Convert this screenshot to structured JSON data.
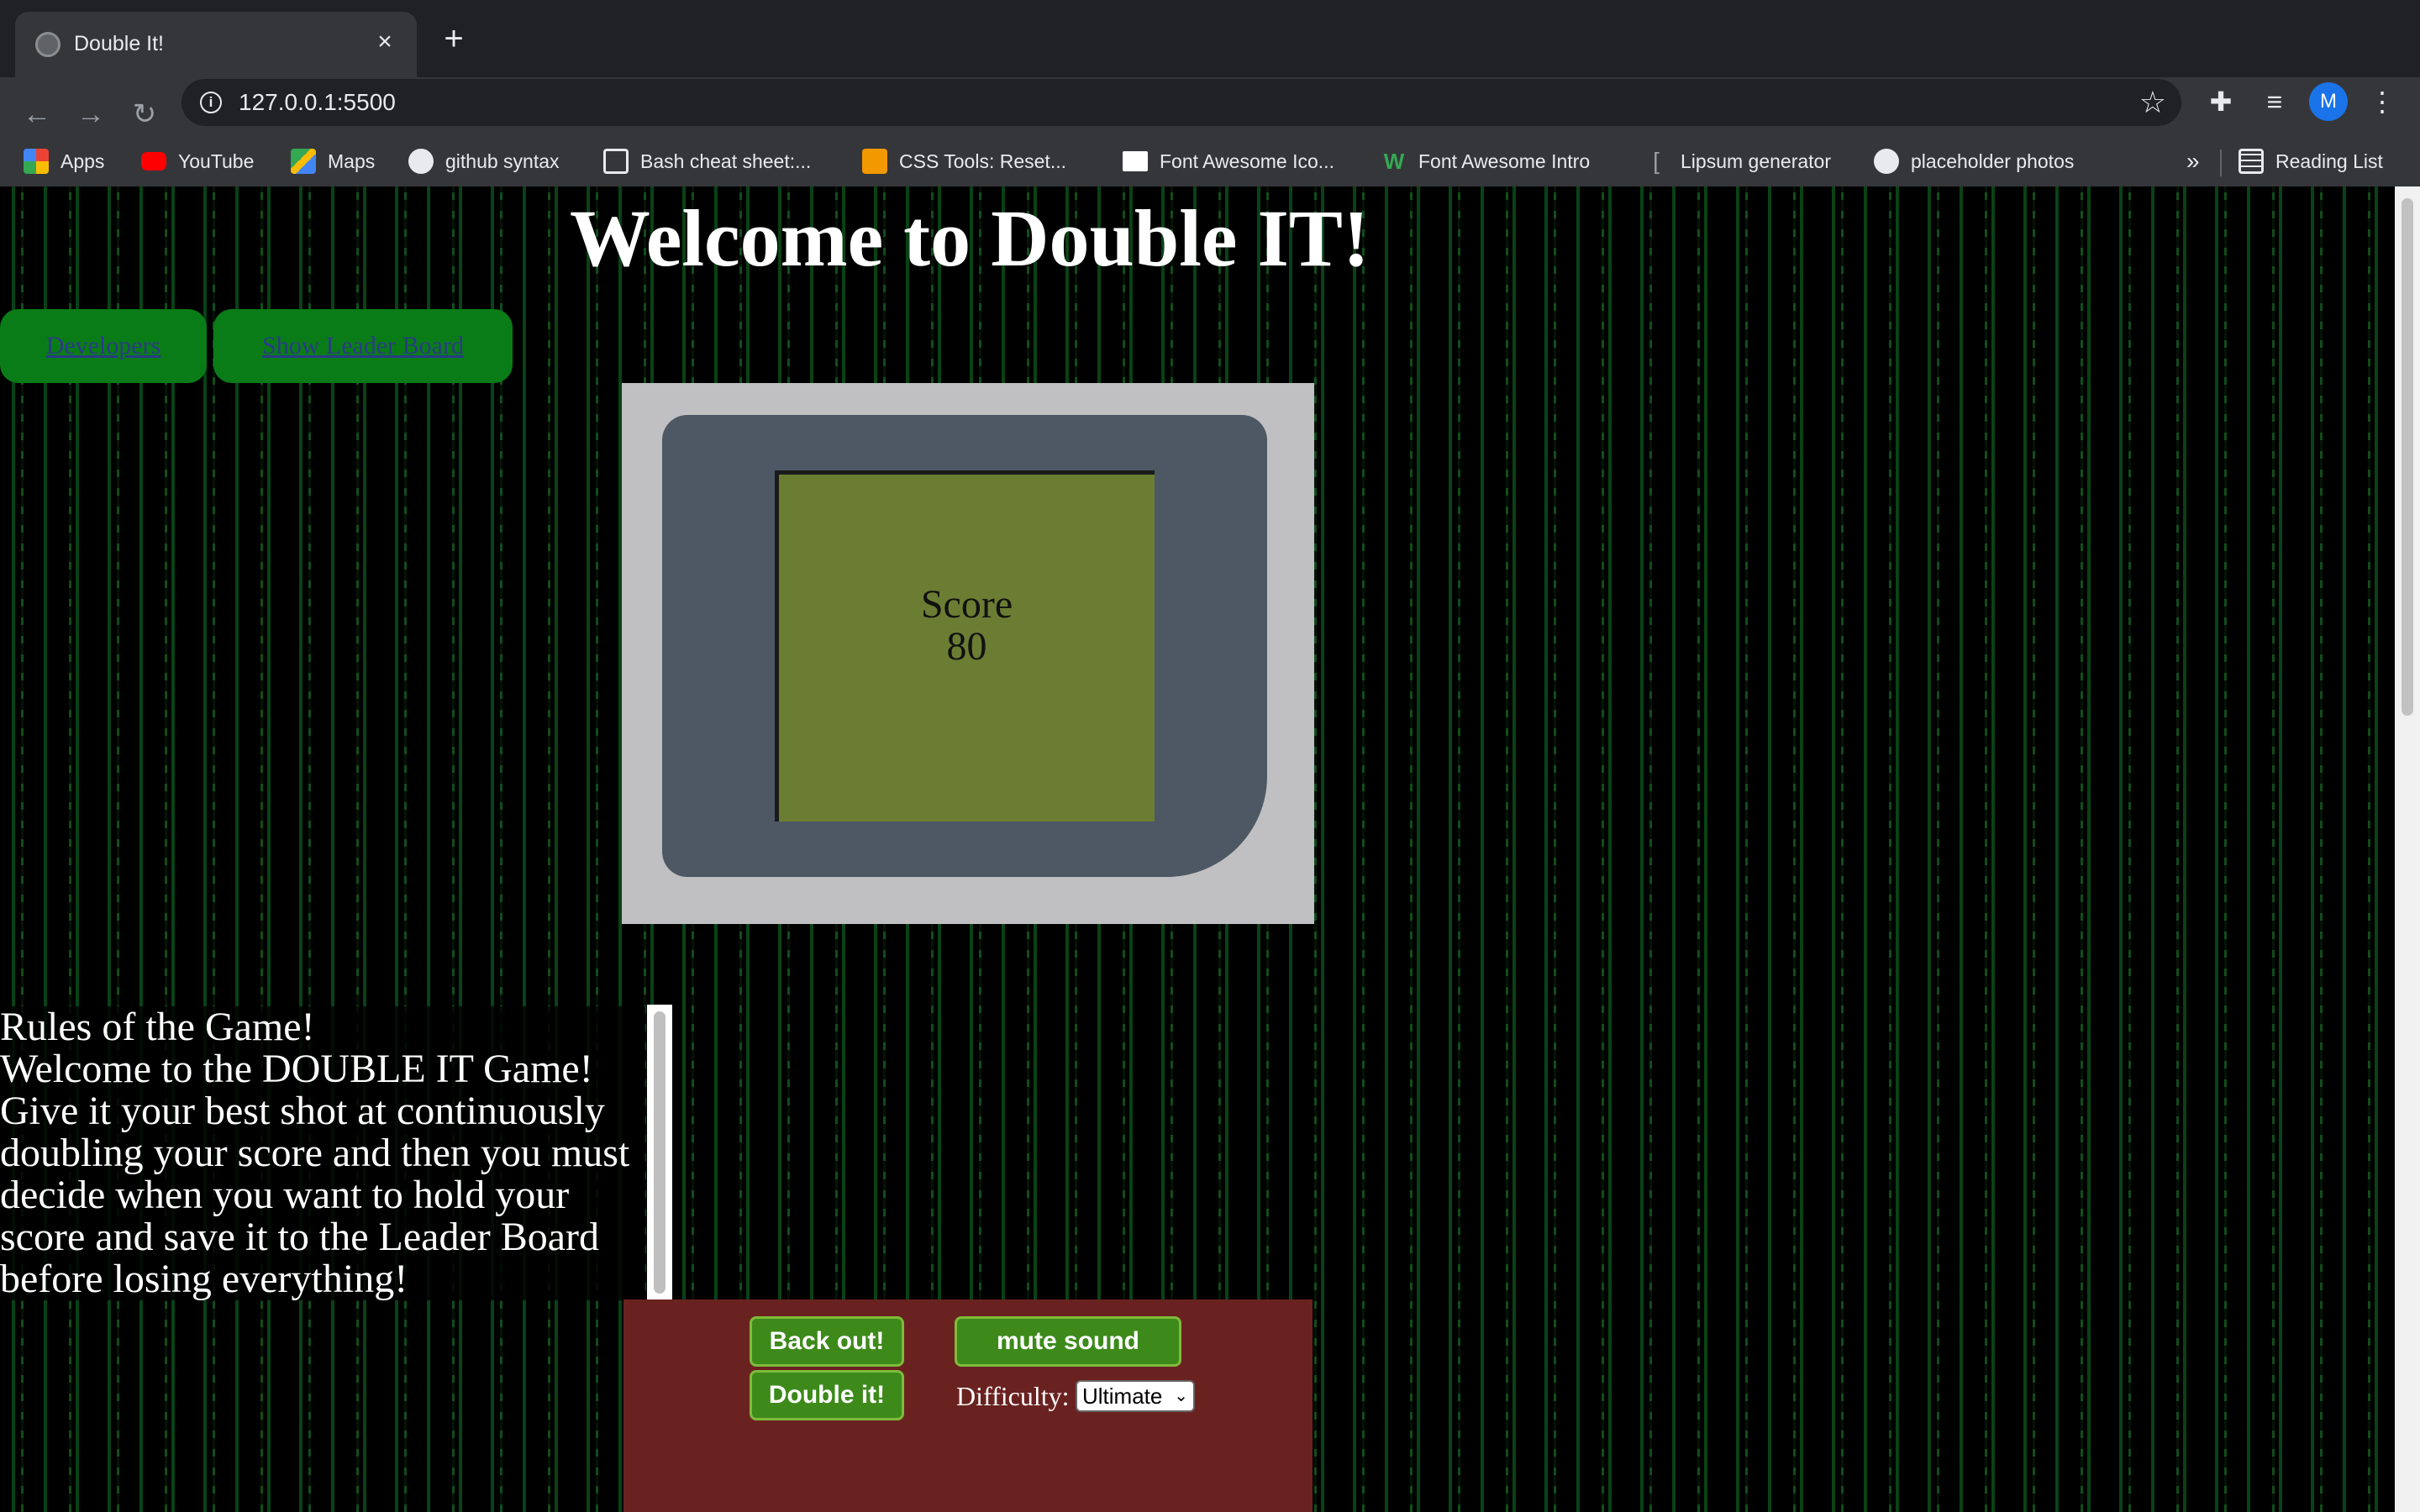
{
  "browser": {
    "tab": {
      "title": "Double It!",
      "close": "×"
    },
    "new_tab": "+",
    "nav": {
      "back": "←",
      "forward": "→",
      "reload": "↻"
    },
    "address": {
      "info": "i",
      "url": "127.0.0.1:5500",
      "star": "☆"
    },
    "toolbar_icons": {
      "extensions": "✚",
      "media": "≡",
      "profile": "M",
      "menu": "⋮"
    },
    "bookmarks": [
      {
        "label": "Apps",
        "icon": "apps-grid-icon",
        "color": "#ea4335"
      },
      {
        "label": "YouTube",
        "icon": "youtube-icon",
        "color": "#ff0000"
      },
      {
        "label": "Maps",
        "icon": "maps-icon",
        "color": "#34a853"
      },
      {
        "label": "github syntax",
        "icon": "github-icon",
        "color": "#e8eaed"
      },
      {
        "label": "Bash cheat sheet:...",
        "icon": "terminal-icon",
        "color": "#e8eaed"
      },
      {
        "label": "CSS Tools: Reset...",
        "icon": "tiger-icon",
        "color": "#f29900"
      },
      {
        "label": "Font Awesome Ico...",
        "icon": "flag-icon",
        "color": "#ffffff"
      },
      {
        "label": "Font Awesome Intro",
        "icon": "w-logo-icon",
        "color": "#34a853"
      },
      {
        "label": "Lipsum generator",
        "icon": "bracket-icon",
        "color": "#9aa0a6"
      },
      {
        "label": "placeholder photos",
        "icon": "globe-icon",
        "color": "#e8eaed"
      }
    ],
    "bookmarks_overflow": "»",
    "reading_list": "Reading List"
  },
  "page": {
    "title": "Welcome to Double IT!",
    "nav_buttons": {
      "developers": "Developers",
      "leaderboard": "Show Leader Board"
    },
    "score": {
      "label": "Score",
      "value": "80"
    },
    "rules": {
      "heading": "Rules of the Game!",
      "body": "Welcome to the DOUBLE IT Game! Give it your best shot at continuously doubling your score and then you must decide when you want to hold your score and save it to the Leader Board before losing everything!"
    },
    "controls": {
      "back_out": "Back out!",
      "mute": "mute sound",
      "double": "Double it!",
      "difficulty_label": "Difficulty:",
      "difficulty_value": "Ultimate"
    }
  },
  "colors": {
    "nav_button": "#0a7c17",
    "console": "#c0c0c2",
    "bezel": "#4d5864",
    "screen": "#6b7d33",
    "controls_panel": "#6a2221",
    "game_button": "#3d8a1b"
  }
}
